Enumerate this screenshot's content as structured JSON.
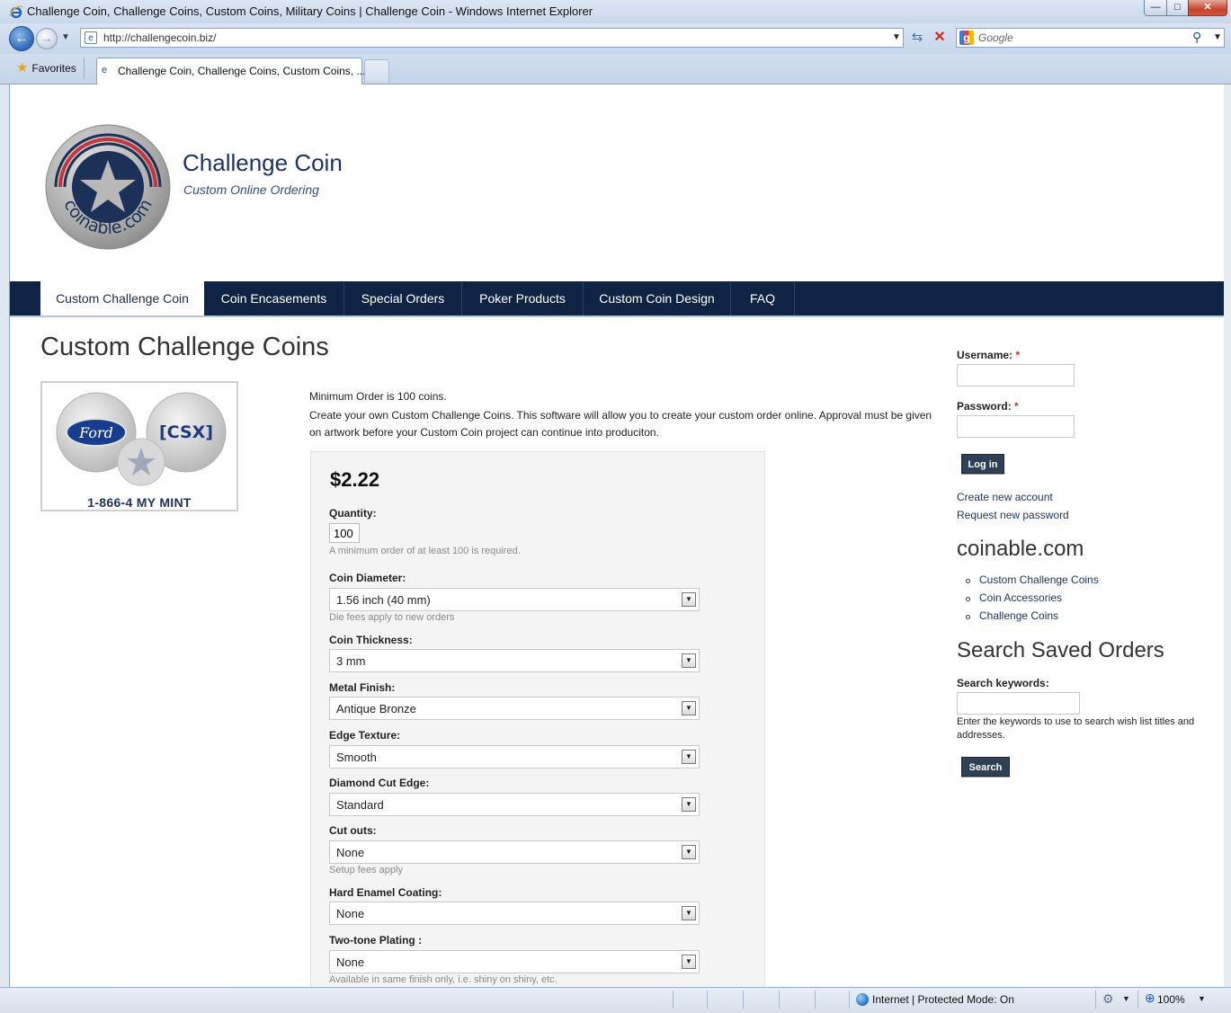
{
  "browser": {
    "window_title": "Challenge Coin, Challenge Coins, Custom Coins, Military Coins | Challenge Coin - Windows Internet Explorer",
    "address_url": "http://challengecoin.biz/",
    "search_placeholder": "Google",
    "favorites_label": "Favorites",
    "tab_label": "Challenge Coin, Challenge Coins, Custom Coins, ...",
    "status_zone": "Internet | Protected Mode: On",
    "zoom": "100%",
    "icons": {
      "back": "back-arrow-icon",
      "forward": "forward-arrow-icon",
      "refresh": "refresh-icon",
      "stop": "stop-icon",
      "search": "magnifier-icon",
      "favorites": "star-icon"
    }
  },
  "site": {
    "name": "Challenge Coin",
    "slogan": "Custom Online Ordering",
    "logo_text": "coinable.com"
  },
  "nav": {
    "items": [
      {
        "label": "Custom Challenge Coin",
        "active": true
      },
      {
        "label": "Coin Encasements"
      },
      {
        "label": "Special Orders"
      },
      {
        "label": "Poker Products"
      },
      {
        "label": "Custom Coin Design"
      },
      {
        "label": "FAQ"
      }
    ]
  },
  "main": {
    "title": "Custom Challenge Coins",
    "product_image": {
      "left_coin_text": "Ford",
      "right_coin_text": "[CSX]",
      "phone": "1-866-4 MY MINT"
    },
    "min_order": "Minimum Order is 100 coins.",
    "description": "Create your own Custom Challenge Coins. This software will allow you to create your custom order online. Approval must be given on artwork before your Custom Coin project can continue into produciton.",
    "form": {
      "price": "$2.22",
      "quantity_label": "Quantity:",
      "quantity_value": "100",
      "quantity_help": "A minimum order of at least 100 is required.",
      "diameter_label": "Coin Diameter:",
      "diameter_value": "1.56 inch (40 mm)",
      "diameter_help": "Die fees apply to new orders",
      "thickness_label": "Coin Thickness:",
      "thickness_value": "3 mm",
      "finish_label": "Metal Finish:",
      "finish_value": "Antique Bronze",
      "edge_label": "Edge Texture:",
      "edge_value": "Smooth",
      "diamond_label": "Diamond Cut Edge:",
      "diamond_value": "Standard",
      "cutouts_label": "Cut outs:",
      "cutouts_value": "None",
      "cutouts_help": "Setup fees apply",
      "enamel_label": "Hard Enamel Coating:",
      "enamel_value": "None",
      "plating_label": "Two-tone Plating :",
      "plating_value": "None",
      "plating_help": "Available in same finish only, i.e. shiny on shiny, etc."
    }
  },
  "sidebar": {
    "username_label": "Username:",
    "password_label": "Password:",
    "required_mark": "*",
    "login_button": "Log in",
    "create_account": "Create new account",
    "request_password": "Request new password",
    "links_heading": "coinable.com",
    "links": [
      "Custom Challenge Coins",
      "Coin Accessories",
      "Challenge Coins"
    ],
    "search_heading": "Search Saved Orders",
    "search_label": "Search keywords:",
    "search_help": "Enter the keywords to use to search wish list titles and addresses.",
    "search_button": "Search"
  },
  "colors": {
    "nav_bg": "#0f2445",
    "brand_text": "#1d3461",
    "button_bg": "#2f3f55"
  }
}
